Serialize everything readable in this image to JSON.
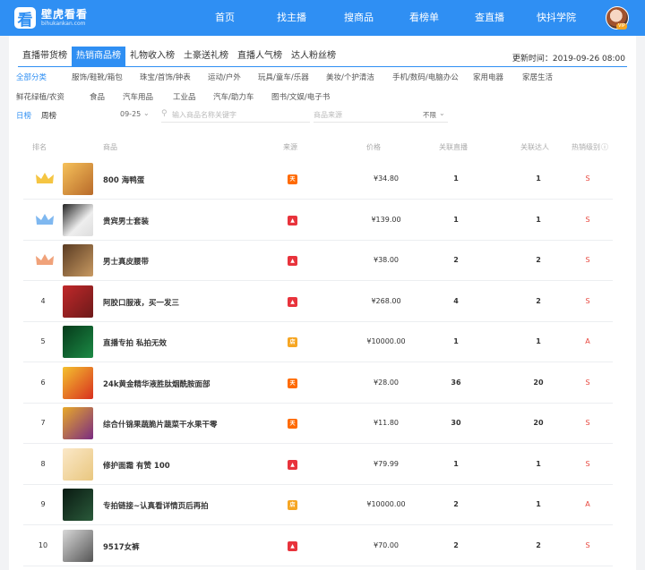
{
  "brand": {
    "title": "壁虎看看",
    "subtitle": "bihukankan.com",
    "mark": "看"
  },
  "nav": [
    "首页",
    "找主播",
    "搜商品",
    "看榜单",
    "查直播",
    "快抖学院"
  ],
  "user": {
    "vip": "VIP"
  },
  "tabs": [
    "直播带货榜",
    "热销商品榜",
    "礼物收入榜",
    "土豪送礼榜",
    "直播人气榜",
    "达人粉丝榜"
  ],
  "active_tab": 1,
  "update_time": "更新时间：2019-09-26 08:00",
  "categories_row1": [
    "全部分类",
    "服饰/鞋靴/箱包",
    "珠宝/首饰/钟表",
    "运动/户外",
    "玩具/童车/乐器",
    "美妆/个护清洁",
    "手机/数码/电脑办公",
    "家用电器",
    "家居生活"
  ],
  "categories_row2": [
    "鲜花绿植/农资",
    "食品",
    "汽车用品",
    "工业品",
    "汽车/助力车",
    "图书/文娱/电子书"
  ],
  "filter": {
    "label": "日榜",
    "period": "周榜",
    "date": "09-25",
    "search_placeholder": "输入商品名称关键字",
    "source_placeholder": "商品来源",
    "source_value": "不限"
  },
  "columns": {
    "rank": "排名",
    "product": "商品",
    "source": "来源",
    "price": "价格",
    "live": "关联直播",
    "talent": "关联达人",
    "level": "热销级别"
  },
  "rows": [
    {
      "rank": "",
      "title": "800 海鸭蛋",
      "source": "tmall",
      "price": "¥34.80",
      "live": "1",
      "talent": "1",
      "level": "S"
    },
    {
      "rank": "",
      "title": "贵宾男士套装",
      "source": "douyin",
      "price": "¥139.00",
      "live": "1",
      "talent": "1",
      "level": "S"
    },
    {
      "rank": "",
      "title": "男士真皮腰带",
      "source": "douyin",
      "price": "¥38.00",
      "live": "2",
      "talent": "2",
      "level": "S"
    },
    {
      "rank": "4",
      "title": "阿胶口服液，买一发三",
      "source": "douyin",
      "price": "¥268.00",
      "live": "4",
      "talent": "2",
      "level": "S"
    },
    {
      "rank": "5",
      "title": "直播专拍 私拍无效",
      "source": "shop",
      "price": "¥10000.00",
      "live": "1",
      "talent": "1",
      "level": "A"
    },
    {
      "rank": "6",
      "title": "24k黄金精华液胜肽烟酰胺面部",
      "source": "tmall",
      "price": "¥28.00",
      "live": "36",
      "talent": "20",
      "level": "S"
    },
    {
      "rank": "7",
      "title": "综合什锦果蔬脆片蔬菜干水果干零",
      "source": "tmall",
      "price": "¥11.80",
      "live": "30",
      "talent": "20",
      "level": "S"
    },
    {
      "rank": "8",
      "title": "修护面霜 有赞 100",
      "source": "douyin",
      "price": "¥79.99",
      "live": "1",
      "talent": "1",
      "level": "S"
    },
    {
      "rank": "9",
      "title": "专拍链接~认真看详情页后再拍",
      "source": "shop",
      "price": "¥10000.00",
      "live": "2",
      "talent": "1",
      "level": "A"
    },
    {
      "rank": "10",
      "title": "9517女裤",
      "source": "douyin",
      "price": "¥70.00",
      "live": "2",
      "talent": "2",
      "level": "S"
    }
  ],
  "colors": {
    "accent": "#2f8ff3",
    "level": "#e8463d",
    "tmall": "#ff6a00",
    "douyin": "#e8333c",
    "shop": "#f6a623"
  }
}
